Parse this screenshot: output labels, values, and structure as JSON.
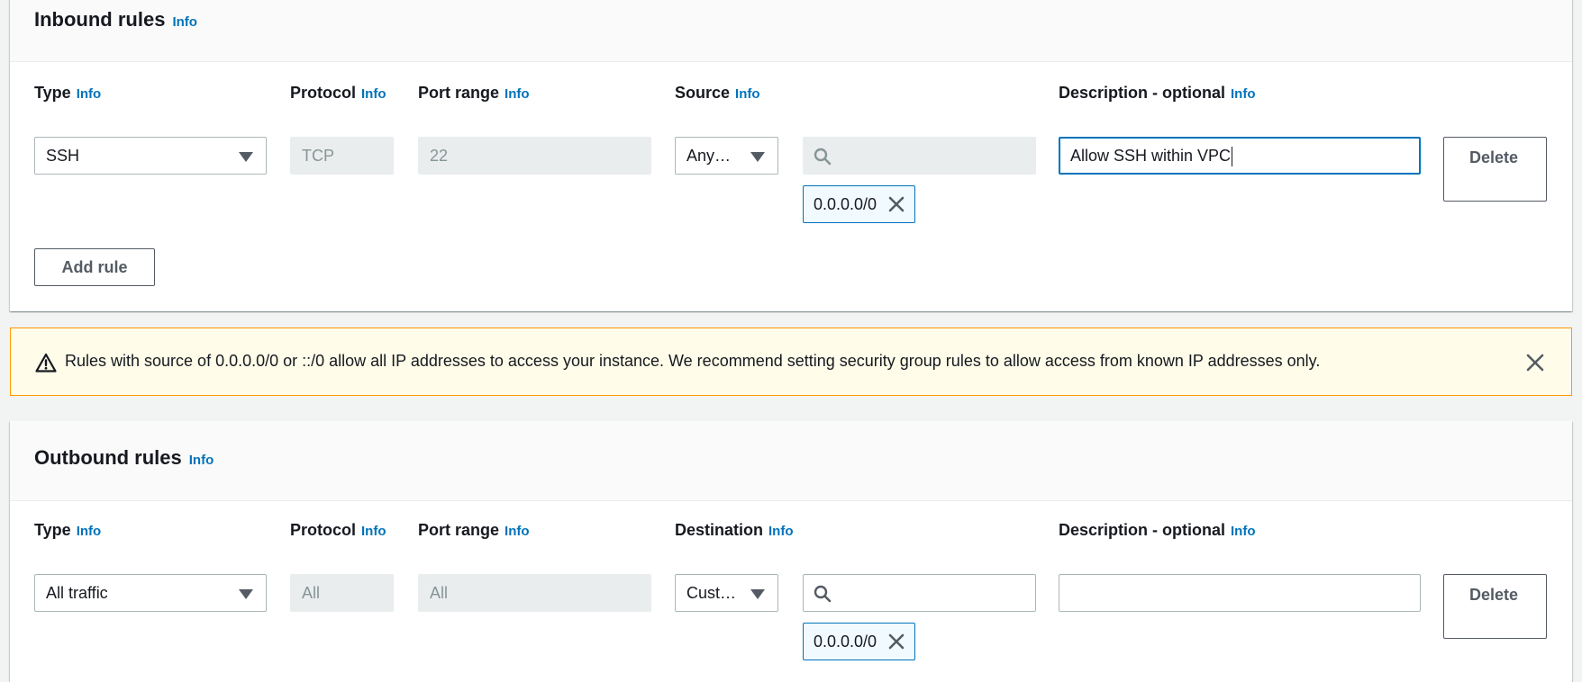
{
  "inbound": {
    "title": "Inbound rules",
    "title_info": "Info",
    "columns": {
      "type": "Type",
      "protocol": "Protocol",
      "port_range": "Port range",
      "source": "Source",
      "description": "Description - optional",
      "info": "Info"
    },
    "rule": {
      "type": "SSH",
      "protocol": "TCP",
      "port_range": "22",
      "source_type": "Any…",
      "search_value": "",
      "token": "0.0.0.0/0",
      "description": "Allow SSH within VPC",
      "delete_label": "Delete"
    },
    "add_rule_label": "Add rule"
  },
  "warning": {
    "text": "Rules with source of 0.0.0.0/0 or ::/0 allow all IP addresses to access your instance. We recommend setting security group rules to allow access from known IP addresses only."
  },
  "outbound": {
    "title": "Outbound rules",
    "title_info": "Info",
    "columns": {
      "type": "Type",
      "protocol": "Protocol",
      "port_range": "Port range",
      "destination": "Destination",
      "description": "Description - optional",
      "info": "Info"
    },
    "rule": {
      "type": "All traffic",
      "protocol": "All",
      "port_range": "All",
      "destination_type": "Cust…",
      "search_value": "",
      "token": "0.0.0.0/0",
      "description": "",
      "delete_label": "Delete"
    }
  },
  "colors": {
    "accent": "#0073bb",
    "warning_border": "#ff9900",
    "warning_bg": "#fffce9",
    "disabled_bg": "#eaeded"
  },
  "icons": [
    "caret-down-icon",
    "search-icon",
    "close-icon",
    "warning-icon"
  ]
}
